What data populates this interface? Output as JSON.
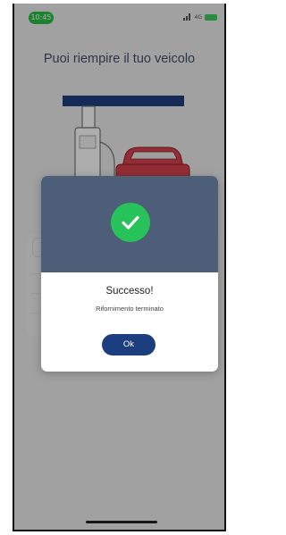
{
  "status_bar": {
    "time": "10:45",
    "network": "4G",
    "time_pill_color": "#28c046",
    "battery_color": "#3fcf5c",
    "icons": [
      "signal-icon",
      "battery-icon"
    ]
  },
  "page": {
    "title": "Puoi riempire il tuo veicolo",
    "title_color": "#40526b"
  },
  "illustration": {
    "icons": [
      "fuel-pump-icon",
      "car-icon"
    ],
    "car_color": "#d9434f",
    "pump_color": "#1f3f7c"
  },
  "modal": {
    "title": "Successo!",
    "message": "Rifornimento terminato",
    "ok_label": "Ok",
    "header_color": "#4c5e78",
    "check_color": "#27c25a",
    "button_color": "#1c3e7f",
    "icons": [
      "check-circle-icon"
    ]
  }
}
